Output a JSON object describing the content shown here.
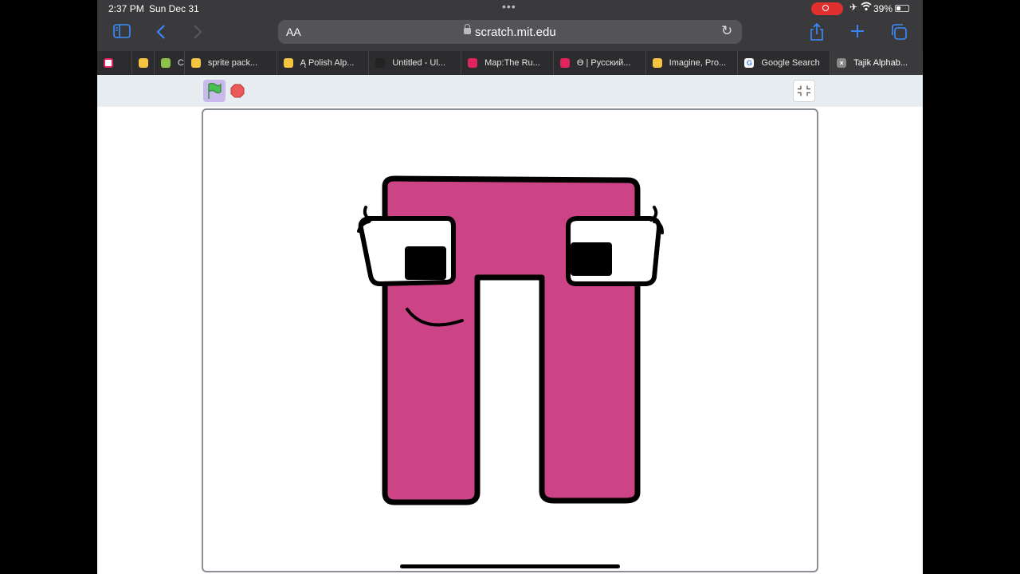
{
  "status_bar": {
    "time": "2:37 PM",
    "date": "Sun Dec 31",
    "battery_percent": "39%",
    "battery_level": 0.39,
    "icons": [
      "screen-record-icon",
      "airplane-icon",
      "wifi-icon",
      "battery-icon"
    ]
  },
  "toolbar": {
    "text_size_label": "AA",
    "url": "scratch.mit.edu",
    "accent_color": "#3a8dff",
    "icons": [
      "sidebar-icon",
      "back-icon",
      "forward-icon",
      "lock-icon",
      "reload-icon",
      "share-icon",
      "new-tab-icon",
      "tabs-overview-icon"
    ]
  },
  "tabs": [
    {
      "label": "",
      "favicon": "app-icon",
      "favicon_color": "#ffffff"
    },
    {
      "label": "",
      "favicon": "scratch-icon",
      "favicon_color": "#f5c542"
    },
    {
      "label": "Cr",
      "favicon": "green-icon",
      "favicon_color": "#8bc34a"
    },
    {
      "label": "sprite pack...",
      "favicon": "scratch-icon",
      "favicon_color": "#f5c542"
    },
    {
      "label": "Ą Polish Alp...",
      "favicon": "scratch-icon",
      "favicon_color": "#f5c542"
    },
    {
      "label": "Untitled - Ul...",
      "favicon": "js-icon",
      "favicon_color": "#222222"
    },
    {
      "label": "Map:The Ru...",
      "favicon": "fandom-icon",
      "favicon_color": "#e0245e"
    },
    {
      "label": "Ө | Русский...",
      "favicon": "fandom-icon",
      "favicon_color": "#e0245e"
    },
    {
      "label": "Imagine, Pro...",
      "favicon": "scratch-icon",
      "favicon_color": "#f5c542"
    },
    {
      "label": "Google Search",
      "favicon": "google-icon",
      "favicon_color": "#ffffff"
    },
    {
      "label": "Tajik Alphab...",
      "favicon": "close-icon",
      "favicon_color": "#888888",
      "active": true
    }
  ],
  "scratch": {
    "flag_color": "#4cbf56",
    "stop_color": "#ec5959",
    "sprite_fill": "#cc4386",
    "sprite_outline": "#000000"
  }
}
